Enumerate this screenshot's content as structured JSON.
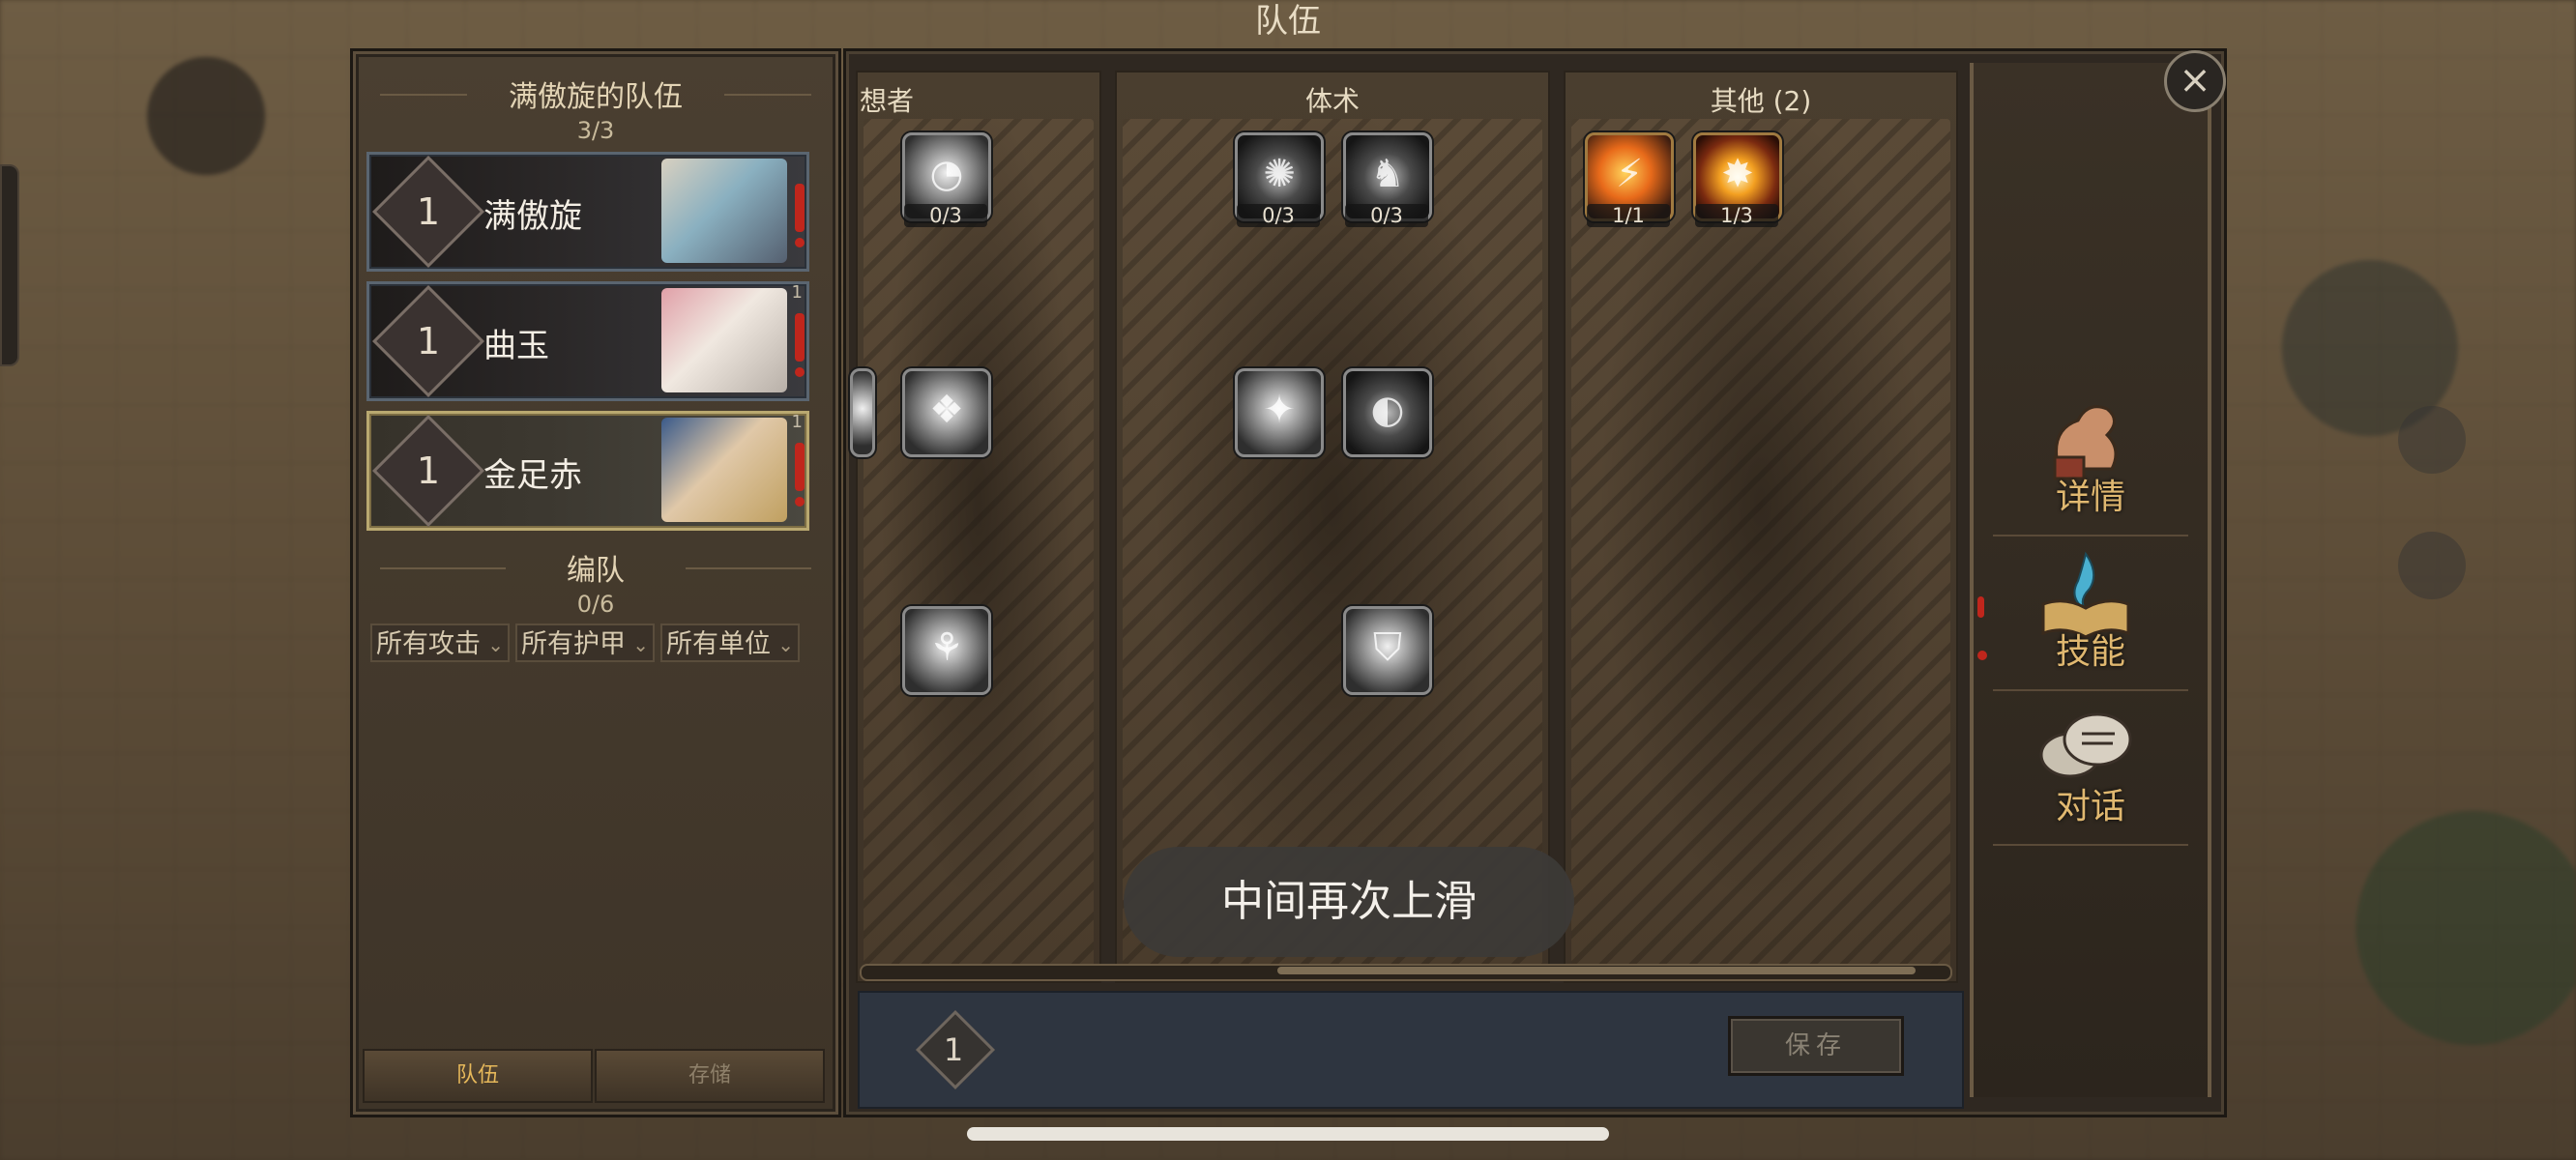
{
  "screen_title": "队伍",
  "team_panel": {
    "title": "满傲旋的队伍",
    "count": "3/3",
    "heroes": [
      {
        "level": "1",
        "name": "满傲旋",
        "tag": ""
      },
      {
        "level": "1",
        "name": "曲玉",
        "tag": "1"
      },
      {
        "level": "1",
        "name": "金足赤",
        "tag": "1"
      }
    ],
    "formation_title": "编队",
    "formation_count": "0/6",
    "filters": [
      "所有攻击",
      "所有护甲",
      "所有单位"
    ],
    "tabs": [
      "队伍",
      "存储"
    ]
  },
  "skill_columns": [
    {
      "title": "想者",
      "skills": [
        {
          "count": "0/3"
        },
        {
          "count": ""
        },
        {
          "count": ""
        }
      ]
    },
    {
      "title": "体术",
      "skills": [
        {
          "count": "0/3"
        },
        {
          "count": "0/3"
        },
        {
          "count": ""
        },
        {
          "count": ""
        },
        {
          "count": ""
        }
      ]
    },
    {
      "title": "其他 (2)",
      "skills": [
        {
          "count": "1/1"
        },
        {
          "count": "1/3"
        }
      ]
    }
  ],
  "bottom_bar": {
    "level": "1",
    "save_label": "保存"
  },
  "sidebar": {
    "items": [
      "详情",
      "技能",
      "对话"
    ]
  },
  "toast": "中间再次上滑",
  "icons": {
    "close": "close-icon",
    "alert": "alert-icon"
  },
  "colors": {
    "accent_gold": "#e0b870",
    "alert_red": "#c0261c",
    "active_tab": "#e6b85a"
  }
}
